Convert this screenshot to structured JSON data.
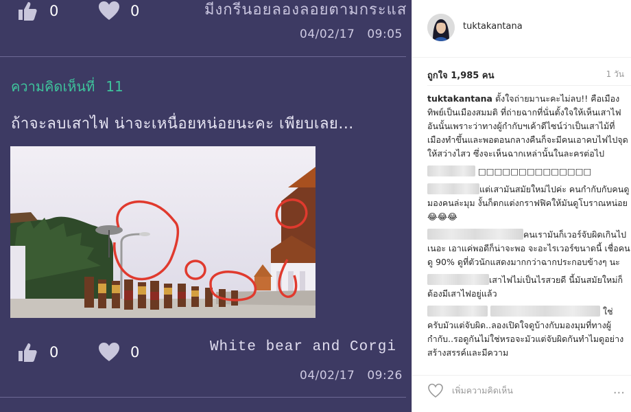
{
  "forum": {
    "top_post": {
      "like_count": "0",
      "heart_count": "0",
      "text_fragment": "มีงกรีนอยลองลอยตามกระแส",
      "date": "04/02/17",
      "time": "09:05"
    },
    "comment": {
      "label": "ความคิดเห็นที่",
      "number": "11",
      "text": "ถ้าจะลบเสาไฟ น่าจะเหนื่อยหน่อยนะคะ เพียบเลย...",
      "like_count": "0",
      "heart_count": "0",
      "author": "White bear and Corgi",
      "date": "04/02/17",
      "time": "09:26"
    }
  },
  "instagram": {
    "username": "tuktakantana",
    "likes": "ถูกใจ 1,985 คน",
    "age": "1 วัน",
    "caption_user": "tuktakantana",
    "caption": "ตั้งใจถ่ายมานะคะไม่ลบ!! คือเมืองทิพย์เป็นเมืองสมมติ ที่ถ่ายฉากที่นั่นตั้งใจให้เห็นเสาไฟอันนั้นเพราะว่าทางผู้กำกับฯเค้าดีไซน์ว่าเป็นเสาไม้ที่เมืองทำขึ้นและพอตอนกลางคืนก็จะมีคนเอาคบไฟไปจุดให้สว่างไสว ซึ่งจะเห็นฉากเหล่านั้นในละครต่อไป",
    "comments": [
      {
        "text": "□□□□□□□□□□□□□□"
      },
      {
        "text": "แต่เสามันสมัยใหม่ไปค่ะ คนกำกับกับคนดูมองคนล่ะมุม งั้นก็ตกแต่งกราฟฟิคให้มันดูโบราณหน่อย 😂😂😂"
      },
      {
        "text": "คนเรามันก็เวอร์จับผิดเกินไปเนอะ เอาแค่พอดีก็น่าจะพอ จะอะไรเวอร์ขนาดนี้ เชื่อคนดู 90% ดูที่ตัวนักแสดงมากกว่าฉากประกอบข้างๆ นะ"
      },
      {
        "text": "เสาไฟไม่เป็นไรสวยดี นี้มันสมัยใหม่ก็ต้องมีเสาไฟอยู่แล้ว"
      },
      {
        "text": "ใช่ ครับมัวแต่จับผิด..ลองเปิดใจดูบ้างกับมองมุมที่ทางผู้กำกับ..รอดูกันไม่ใช่หรอจะมัวแต่จับผิดกันทำไมดูอย่างสร้างสรรค์และมีความ"
      }
    ],
    "add_comment_placeholder": "เพิ่มความคิดเห็น",
    "more_label": "..."
  }
}
